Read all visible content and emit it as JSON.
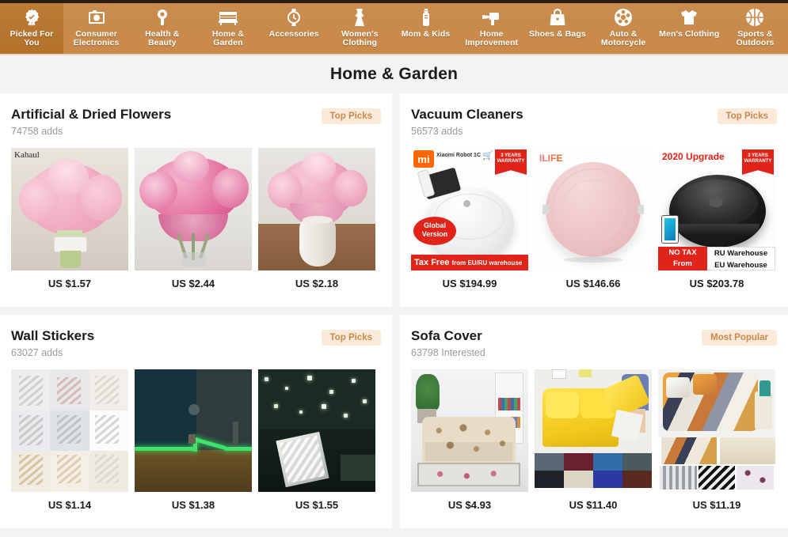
{
  "nav": {
    "items": [
      {
        "label": "Picked For You",
        "icon": "badge-check-icon",
        "active": true
      },
      {
        "label": "Consumer Electronics",
        "icon": "camera-icon",
        "active": false
      },
      {
        "label": "Health & Beauty",
        "icon": "lipstick-icon",
        "active": false
      },
      {
        "label": "Home & Garden",
        "icon": "sofa-icon",
        "active": false
      },
      {
        "label": "Accessories",
        "icon": "watch-icon",
        "active": false
      },
      {
        "label": "Women's Clothing",
        "icon": "dress-icon",
        "active": false
      },
      {
        "label": "Mom & Kids",
        "icon": "baby-bottle-icon",
        "active": false
      },
      {
        "label": "Home Improvement",
        "icon": "drill-icon",
        "active": false
      },
      {
        "label": "Shoes & Bags",
        "icon": "handbag-icon",
        "active": false
      },
      {
        "label": "Auto & Motorcycle",
        "icon": "wheel-icon",
        "active": false
      },
      {
        "label": "Men's Clothing",
        "icon": "tshirt-icon",
        "active": false
      },
      {
        "label": "Sports & Outdoors",
        "icon": "basketball-icon",
        "active": false
      }
    ]
  },
  "page": {
    "title": "Home & Garden"
  },
  "colors": {
    "nav_background": "#c98a4b",
    "nav_active_background": "#b9772f",
    "badge_text": "#c98a4b",
    "badge_background": "#fbe9da",
    "page_background": "#f3f3f3",
    "card_background": "#ffffff"
  },
  "cards": [
    {
      "title": "Artificial & Dried Flowers",
      "subtitle": "74758 adds",
      "badge": "Top Picks",
      "products": [
        {
          "price": "US $1.57",
          "image": "pink-carnation-bouquet",
          "watermark": "Kahaul"
        },
        {
          "price": "US $2.44",
          "image": "pink-peony-bouquet-in-vase",
          "watermark": ""
        },
        {
          "price": "US $2.18",
          "image": "pink-roses-white-vase",
          "watermark": ""
        }
      ]
    },
    {
      "title": "Vacuum Cleaners",
      "subtitle": "56573 adds",
      "badge": "Top Picks",
      "products": [
        {
          "price": "US $194.99",
          "image": "xiaomi-white-robot-vacuum",
          "overlays": {
            "brand": "mi",
            "model": "Xiaomi Robot 1C",
            "warranty": "3 YEARS WARRANTY",
            "circle_badge": "Global Version",
            "banner_main": "Tax Free",
            "banner_sub": "from EU/RU warehouse"
          }
        },
        {
          "price": "US $146.66",
          "image": "pink-robot-vacuum",
          "overlays": {
            "brand": "ILIFE"
          }
        },
        {
          "price": "US $203.78",
          "image": "black-robot-vacuum",
          "overlays": {
            "headline": "2020 Upgrade",
            "warranty": "3 YEARS WARRANTY",
            "banner_left_line1": "NO TAX",
            "banner_left_line2": "From",
            "banner_right_line1": "RU Warehouse",
            "banner_right_line2": "EU Warehouse"
          }
        }
      ]
    },
    {
      "title": "Wall Stickers",
      "subtitle": "63027 adds",
      "badge": "Top Picks",
      "products": [
        {
          "price": "US $1.14",
          "image": "3d-butterfly-wall-stickers-grid"
        },
        {
          "price": "US $1.38",
          "image": "glow-in-dark-green-wall-strip"
        },
        {
          "price": "US $1.55",
          "image": "glow-stars-ceiling-stickers"
        }
      ]
    },
    {
      "title": "Sofa Cover",
      "subtitle": "63798 Interested",
      "badge": "Most Popular",
      "products": [
        {
          "price": "US $4.93",
          "image": "floral-beige-sofa-cover-livingroom"
        },
        {
          "price": "US $11.40",
          "image": "yellow-stretch-sofa-cover-with-color-swatches"
        },
        {
          "price": "US $11.19",
          "image": "geometric-print-sofa-cover-with-swatches"
        }
      ]
    }
  ]
}
